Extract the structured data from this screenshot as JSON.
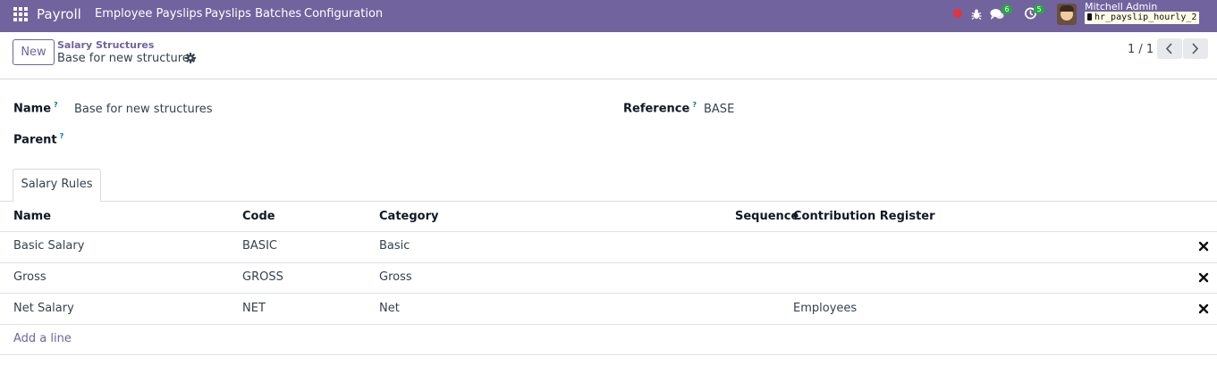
{
  "navbar": {
    "brand": "Payroll",
    "menu": [
      "Employee Payslips",
      "Payslips Batches",
      "Configuration"
    ],
    "chat_badge": "6",
    "activity_badge": "5",
    "user_name": "Mitchell Admin",
    "database": "hr_payslip_hourly_2",
    "accent_color": "#71639e"
  },
  "control_panel": {
    "new_label": "New",
    "breadcrumb_parent": "Salary Structures",
    "breadcrumb_current": "Base for new structures",
    "pager": "1 / 1"
  },
  "form": {
    "name_label": "Name",
    "name_value": "Base for new structures",
    "reference_label": "Reference",
    "reference_value": "BASE",
    "parent_label": "Parent",
    "parent_value": "",
    "help_mark": "?"
  },
  "tabs": [
    {
      "label": "Salary Rules",
      "active": true
    }
  ],
  "table": {
    "columns": [
      "Name",
      "Code",
      "Category",
      "Sequence",
      "Contribution Register"
    ],
    "rows": [
      {
        "name": "Basic Salary",
        "code": "BASIC",
        "category": "Basic",
        "sequence": "",
        "register": ""
      },
      {
        "name": "Gross",
        "code": "GROSS",
        "category": "Gross",
        "sequence": "",
        "register": ""
      },
      {
        "name": "Net Salary",
        "code": "NET",
        "category": "Net",
        "sequence": "",
        "register": "Employees"
      }
    ],
    "add_line_label": "Add a line"
  }
}
